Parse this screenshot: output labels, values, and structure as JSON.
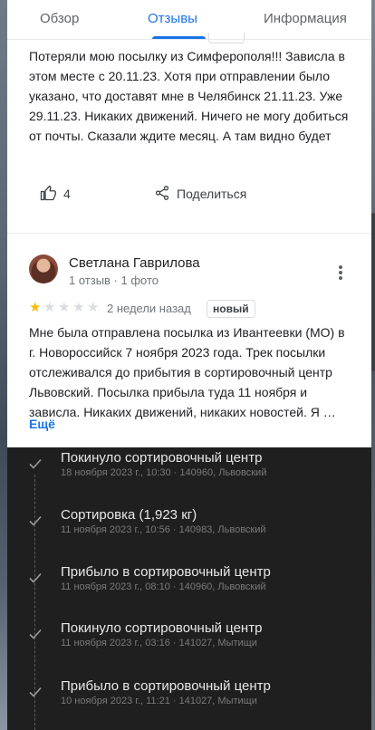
{
  "tabs": [
    {
      "label": "Обзор"
    },
    {
      "label": "Отзывы"
    },
    {
      "label": "Информация"
    }
  ],
  "review_1": {
    "text": "Потеряли мою посылку из Симферополя!!! Зависла в этом месте с 20.11.23. Хотя при отправлении было указано, что доставят мне в Челябинск 21.11.23. Уже 29.11.23. Никаких движений. Ничего не могу добиться от почты. Сказали ждите месяц. А там видно будет",
    "likes": "4",
    "share_label": "Поделиться"
  },
  "review_2": {
    "name": "Светлана Гаврилова",
    "meta": "1 отзыв · 1 фото",
    "rating": 1,
    "max_rating": 5,
    "date": "2 недели назад",
    "badge": "новый",
    "text": "Мне была отправлена посылка из Ивантеевки (МО) в г. Новороссийск 7 ноября 2023 года. Трек посылки отслеживался до прибытия в сортировочный центр Львовский. Посылка прибыла туда 11 ноября и зависла. Никаких движений, никаких новостей. Я …",
    "more_label": "Ещё"
  },
  "tracking": [
    {
      "title": "Покинуло сортировочный центр",
      "sub": "18 ноября 2023 г., 10:30 · 140960, Львовский"
    },
    {
      "title": "Сортировка (1,923 кг)",
      "sub": "11 ноября 2023 г., 10:56 · 140983, Львовский"
    },
    {
      "title": "Прибыло в сортировочный центр",
      "sub": "11 ноября 2023 г., 08:10 · 140960, Львовский"
    },
    {
      "title": "Покинуло сортировочный центр",
      "sub": "11 ноября 2023 г., 03:16 · 141027, Мытищи"
    },
    {
      "title": "Прибыло в сортировочный центр",
      "sub": "10 ноября 2023 г., 11:21 · 141027, Мытищи"
    }
  ],
  "colors": {
    "accent": "#1a73e8",
    "star_on": "#fbbc04",
    "star_off": "#dadce0"
  },
  "icons": {
    "like": "thumb-up-icon",
    "share": "share-icon",
    "more": "more-vert-icon",
    "check": "check-icon"
  }
}
